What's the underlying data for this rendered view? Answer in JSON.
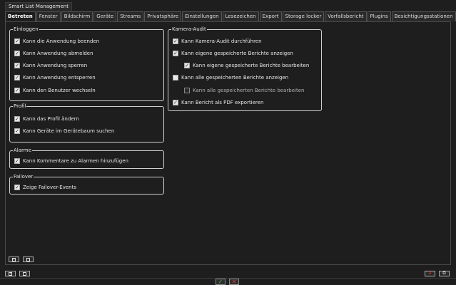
{
  "window": {
    "title": "Smart List Management"
  },
  "tabs": [
    {
      "label": "Betreten",
      "active": true
    },
    {
      "label": "Fenster"
    },
    {
      "label": "Bildschirm"
    },
    {
      "label": "Geräte"
    },
    {
      "label": "Streams"
    },
    {
      "label": "Privatsphäre"
    },
    {
      "label": "Einstellungen"
    },
    {
      "label": "Lesezeichen"
    },
    {
      "label": "Export"
    },
    {
      "label": "Storage locker"
    },
    {
      "label": "Vorfallsbericht"
    },
    {
      "label": "Plugins"
    },
    {
      "label": "Besichtigungsstationen"
    }
  ],
  "groups": {
    "einloggen": {
      "title": "Einloggen",
      "items": [
        {
          "label": "Kann die Anwendung beenden",
          "checked": true
        },
        {
          "label": "Kann Anwendung abmelden",
          "checked": true
        },
        {
          "label": "Kann Anwendung sperren",
          "checked": true
        },
        {
          "label": "Kann Anwendung entsperren",
          "checked": true
        },
        {
          "label": "Kann den Benutzer wechseln",
          "checked": true
        }
      ]
    },
    "profil": {
      "title": "Profil",
      "items": [
        {
          "label": "Kann das Profil ändern",
          "checked": true
        },
        {
          "label": "Kann Geräte im Gerätebaum suchen",
          "checked": true
        }
      ]
    },
    "alarme": {
      "title": "Alarme",
      "items": [
        {
          "label": "Kann Kommentare zu Alarmen hinzufügen",
          "checked": true
        }
      ]
    },
    "failover": {
      "title": "Failover",
      "items": [
        {
          "label": "Zeige Failover-Events",
          "checked": true
        }
      ]
    },
    "kamera_audit": {
      "title": "Kamera-Audit",
      "items": [
        {
          "label": "Kann Kamera-Audit durchführen",
          "checked": true
        },
        {
          "label": "Kann eigene gespeicherte Berichte anzeigen",
          "checked": true
        },
        {
          "label": "Kann eigene gespeicherte Berichte bearbeiten",
          "checked": true
        },
        {
          "label": "Kann alle gespeicherten Berichte anzeigen",
          "checked": false
        },
        {
          "label": "Kann alle gespeicherten Berichte bearbeiten",
          "checked": false
        },
        {
          "label": "Kann Bericht als PDF exportieren",
          "checked": true
        }
      ]
    }
  },
  "footer": {
    "ok_glyph": "✓",
    "cancel_glyph": "✕"
  },
  "colors": {
    "background": "#1e1e1e",
    "ok": "#4caf50",
    "cancel": "#e53935"
  }
}
